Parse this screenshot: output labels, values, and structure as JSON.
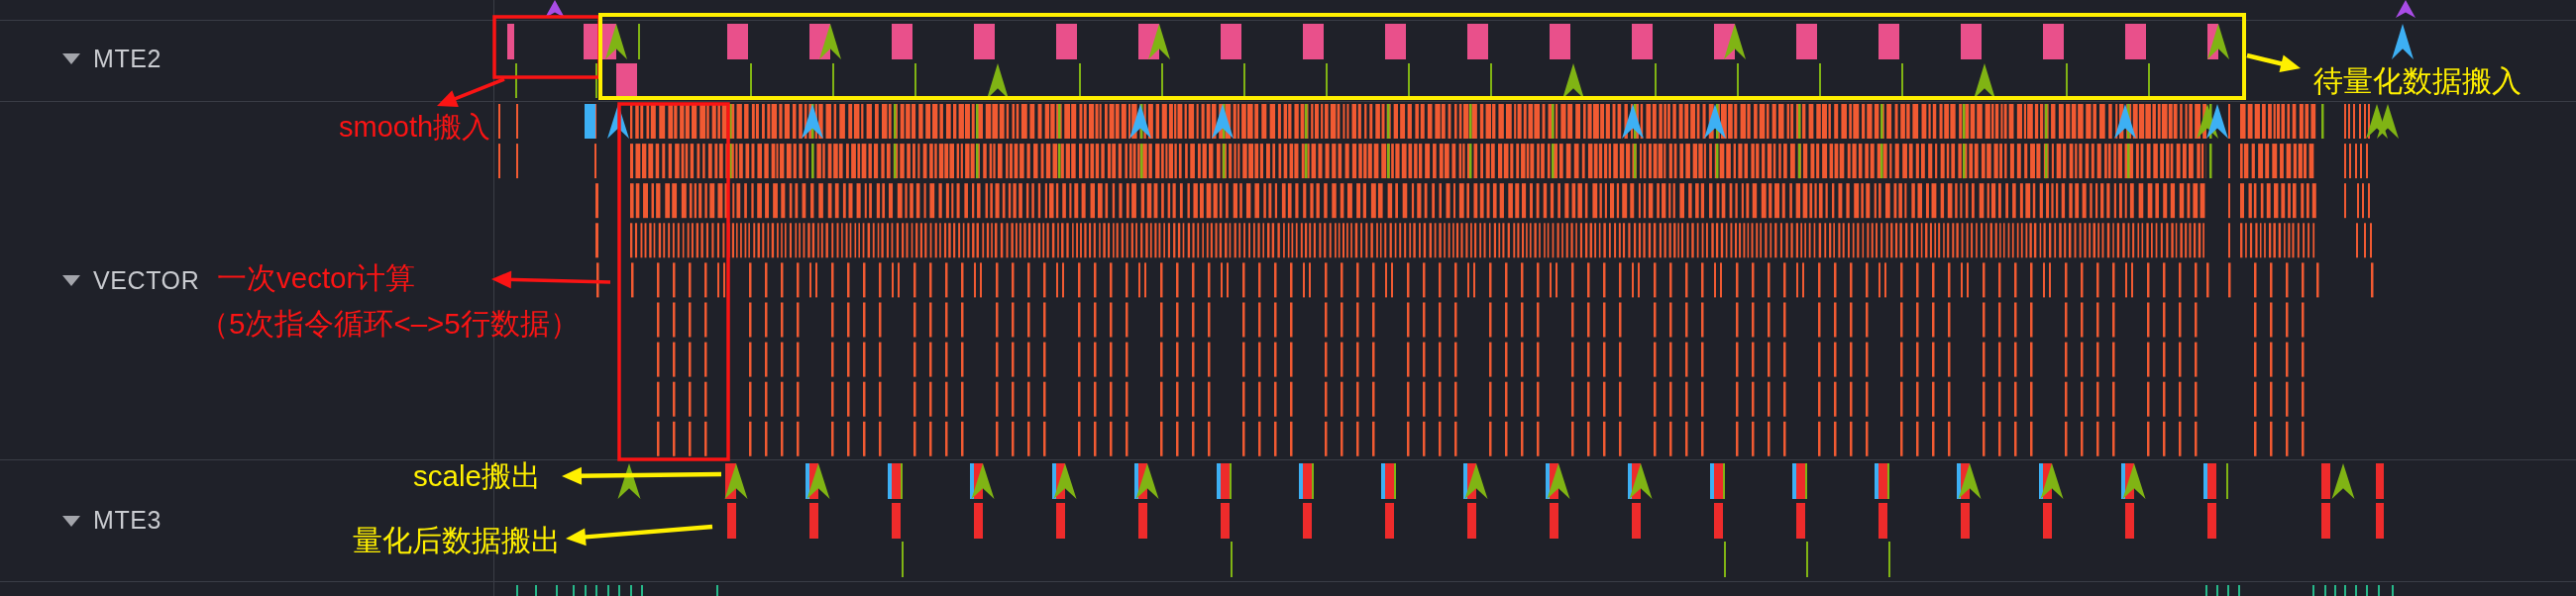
{
  "tracks": [
    {
      "label": "MTE2",
      "expanded": true
    },
    {
      "label": "VECTOR",
      "expanded": true
    },
    {
      "label": "MTE3",
      "expanded": true
    }
  ],
  "annotations": [
    {
      "text": "smooth搬入",
      "color": "#fa1414"
    },
    {
      "text": "一次vector计算",
      "color": "#fa1414"
    },
    {
      "text": "（5次指令循环<–>5行数据）",
      "color": "#fa1414"
    },
    {
      "text": "待量化数据搬入",
      "color": "#fff000"
    },
    {
      "text": "scale搬出",
      "color": "#fff000"
    },
    {
      "text": "量化后数据搬出",
      "color": "#fff000"
    }
  ]
}
